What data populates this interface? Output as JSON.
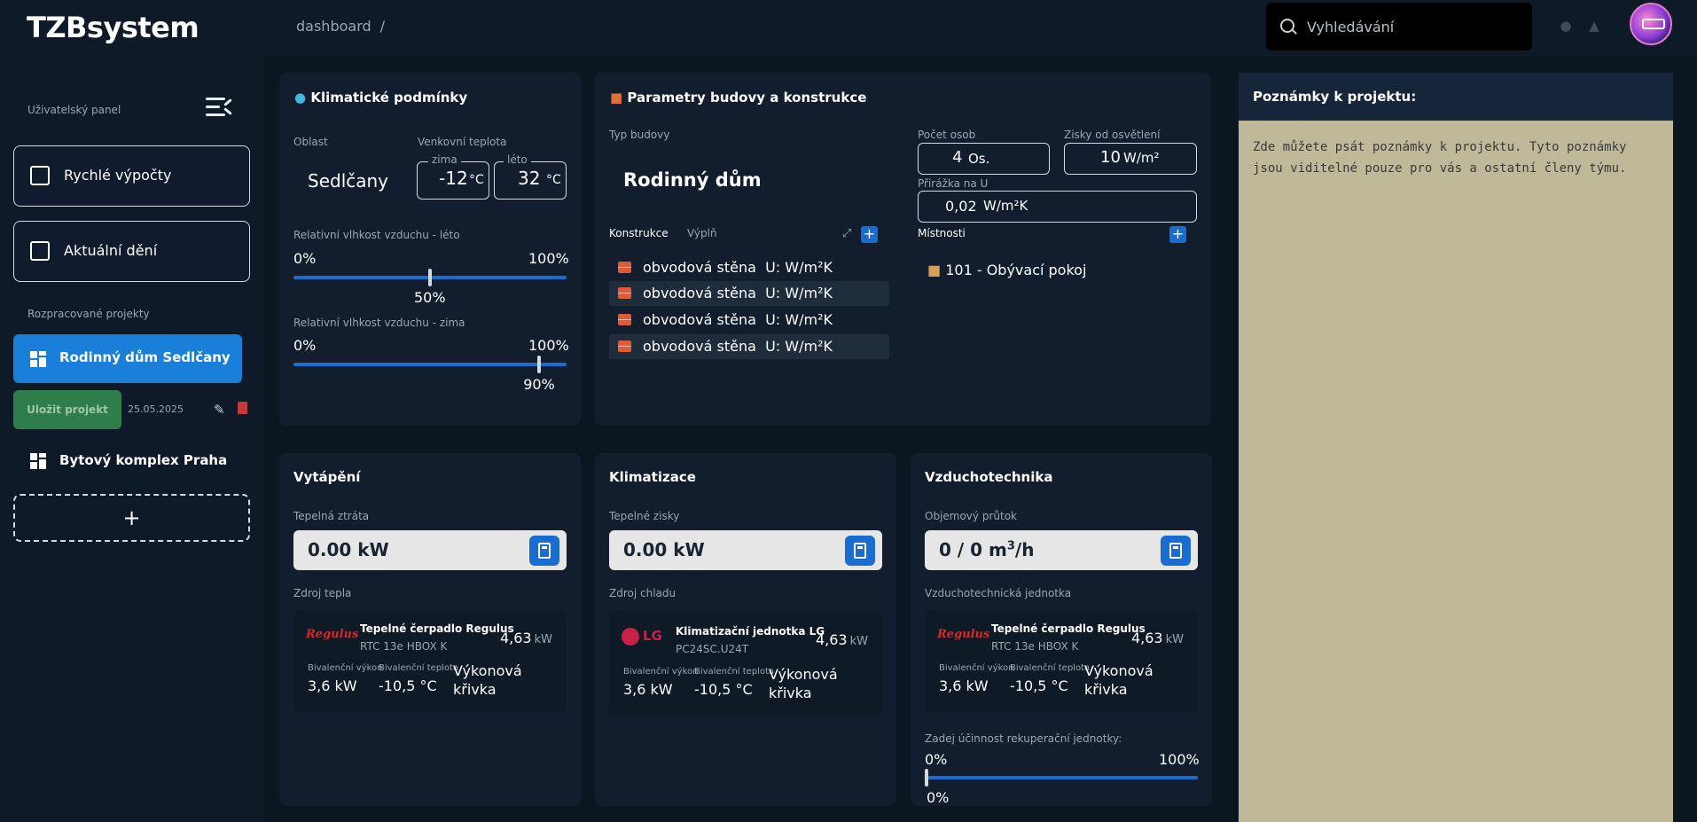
{
  "app": {
    "logo": "TZBsystem"
  },
  "breadcrumb": {
    "item": "dashboard",
    "separator": "/"
  },
  "search": {
    "placeholder": "Vyhledávání"
  },
  "sidebar": {
    "panel_label": "Uživatelský panel",
    "quick_calc": "Rychlé výpočty",
    "current_events": "Aktuální dění",
    "projects_label": "Rozpracované projekty",
    "active_project": "Rodinný dům Sedlčany",
    "save_button": "Uložit projekt",
    "save_date": "25.05.2025",
    "other_project": "Bytový komplex Praha",
    "add_button": "+"
  },
  "climate": {
    "title": "Klimatické podmínky",
    "area_label": "Oblast",
    "area_value": "Sedlčany",
    "outdoor_temp_label": "Venkovní teplota",
    "winter_label": "zima",
    "winter_value": "-12",
    "summer_label": "léto",
    "summer_value": "32",
    "temp_unit": "°C",
    "humidity_summer_label": "Relativní vlhkost vzduchu - léto",
    "humidity_summer": {
      "min": "0%",
      "max": "100%",
      "current": "50%",
      "value": 0.5
    },
    "humidity_winter_label": "Relativní vlhkost vzduchu - zima",
    "humidity_winter": {
      "min": "0%",
      "max": "100%",
      "current": "90%",
      "value": 0.9
    }
  },
  "building": {
    "title": "Parametry budovy a konstrukce",
    "type_label": "Typ budovy",
    "type_value": "Rodinný dům",
    "persons_label": "Počet osob",
    "persons_value": "4",
    "persons_unit": "Os.",
    "lighting_label": "Zisky od osvětlení",
    "lighting_value": "10",
    "lighting_unit": "W/m²",
    "surcharge_label": "Přirážka na U",
    "surcharge_value": "0,02",
    "surcharge_unit": "W/m²K",
    "tab_constructions": "Konstrukce",
    "tab_fillings": "Výplň",
    "constructions": [
      {
        "name": "obvodová stěna",
        "u": "U: W/m²K"
      },
      {
        "name": "obvodová stěna",
        "u": "U: W/m²K"
      },
      {
        "name": "obvodová stěna",
        "u": "U: W/m²K"
      },
      {
        "name": "obvodová stěna",
        "u": "U: W/m²K"
      }
    ],
    "rooms_label": "Místnosti",
    "rooms": [
      {
        "name": "101 - Obývací pokoj"
      }
    ]
  },
  "heating": {
    "title": "Vytápění",
    "loss_label": "Tepelná ztráta",
    "loss_value": "0.00 kW",
    "source_label": "Zdroj tepla",
    "device": {
      "brand": "Regulus",
      "name": "Tepelné čerpadlo Regulus",
      "model": "RTC 13e HBOX K",
      "power": "4,63",
      "power_unit": "kW",
      "biv_power_label": "Bivalenční výkon",
      "biv_power": "3,6 kW",
      "biv_temp_label": "Bivalenční teplota",
      "biv_temp": "-10,5 °C",
      "curve": "Výkonová křivka"
    }
  },
  "cooling": {
    "title": "Klimatizace",
    "gains_label": "Tepelné zisky",
    "gains_value": "0.00 kW",
    "source_label": "Zdroj chladu",
    "device": {
      "brand": "LG",
      "name": "Klimatizační jednotka LG",
      "model": "PC24SC.U24T",
      "power": "4,63",
      "power_unit": "kW",
      "biv_power_label": "Bivalenční výkon",
      "biv_power": "3,6 kW",
      "biv_temp_label": "Bivalenční teplota",
      "biv_temp": "-10,5 °C",
      "curve": "Výkonová křivka"
    }
  },
  "ventilation": {
    "title": "Vzduchotechnika",
    "flow_label": "Objemový průtok",
    "flow_value": "0 / 0 m",
    "flow_exp": "3",
    "flow_suffix": "/h",
    "unit_label": "Vzduchotechnická jednotka",
    "device": {
      "brand": "Regulus",
      "name": "Tepelné čerpadlo Regulus",
      "model": "RTC 13e HBOX K",
      "power": "4,63",
      "power_unit": "kW",
      "biv_power_label": "Bivalenční výkon",
      "biv_power": "3,6 kW",
      "biv_temp_label": "Bivalenční teplota",
      "biv_temp": "-10,5 °C",
      "curve": "Výkonová křivka"
    },
    "recovery_label": "Zadej účinnost rekuperační jednotky:",
    "recovery": {
      "min": "0%",
      "max": "100%",
      "current": "0%",
      "value": 0
    }
  },
  "notes": {
    "title": "Poznámky k projektu:",
    "text": "Zde můžete psát poznámky k projektu. Tyto poznámky jsou viditelné pouze pro vás a ostatní členy týmu."
  },
  "colors": {
    "accent": "#1a7fd8",
    "save": "#2e7d4a",
    "notes_bg": "#bfb99a",
    "delete": "#c23a3a"
  }
}
